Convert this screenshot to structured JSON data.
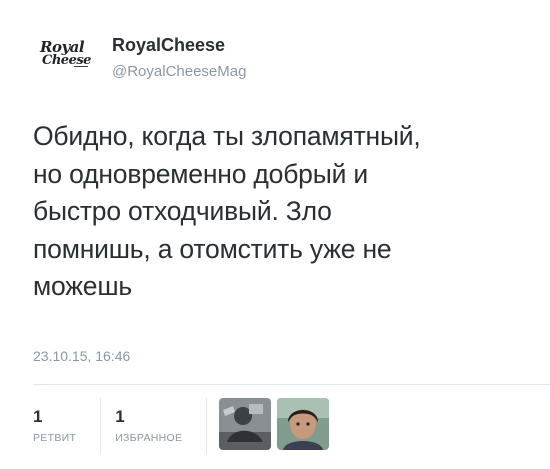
{
  "tweet": {
    "author": {
      "display_name": "RoyalCheese",
      "screen_name": "@RoyalCheeseMag",
      "avatar_logo_line1": "Royal",
      "avatar_logo_line2": "Cheese",
      "avatar_icon": "royal-cheese-logo-icon"
    },
    "text": "Обидно, когда ты злопамятный,\nно одновременно добрый и\nбыстро отходчивый. Зло\nпомнишь, а отомстить уже не\nможешь",
    "timestamp": "23.10.15, 16:46",
    "stats": {
      "retweets": {
        "count": "1",
        "label": "РЕТВИТ"
      },
      "favorites": {
        "count": "1",
        "label": "ИЗБРАННОЕ"
      }
    },
    "favorited_by_icons": [
      "user-avatar-icon",
      "user-avatar-icon"
    ]
  }
}
